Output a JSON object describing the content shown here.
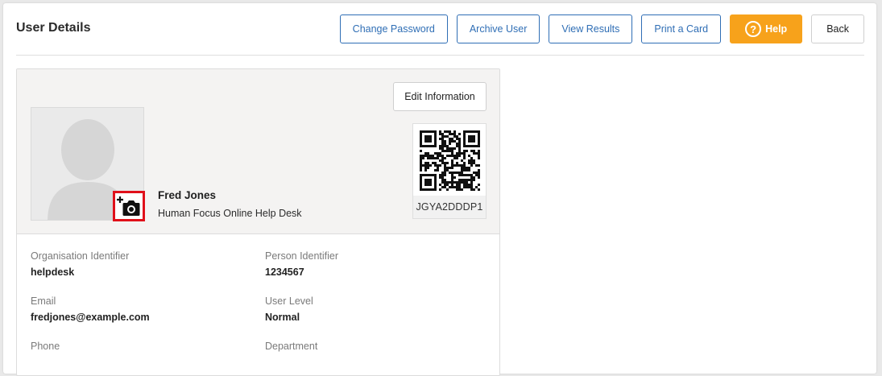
{
  "page": {
    "title": "User Details"
  },
  "toolbar": {
    "change_password": "Change Password",
    "archive_user": "Archive User",
    "view_results": "View Results",
    "print_card": "Print a Card",
    "help": "Help",
    "back": "Back"
  },
  "card": {
    "edit_label": "Edit Information",
    "name": "Fred Jones",
    "organisation": "Human Focus Online Help Desk",
    "qr_code_text": "JGYA2DDDP1",
    "photo_icon": "avatar-silhouette-icon",
    "camera_icon": "add-photo-camera-icon"
  },
  "fields": {
    "organisation_identifier": {
      "label": "Organisation Identifier",
      "value": "helpdesk"
    },
    "person_identifier": {
      "label": "Person Identifier",
      "value": "1234567"
    },
    "email": {
      "label": "Email",
      "value": "fredjones@example.com"
    },
    "user_level": {
      "label": "User Level",
      "value": "Normal"
    },
    "phone": {
      "label": "Phone"
    },
    "department": {
      "label": "Department"
    }
  },
  "colors": {
    "primary": "#2f6eb5",
    "help": "#f7a21b",
    "highlight": "#e0101a"
  }
}
